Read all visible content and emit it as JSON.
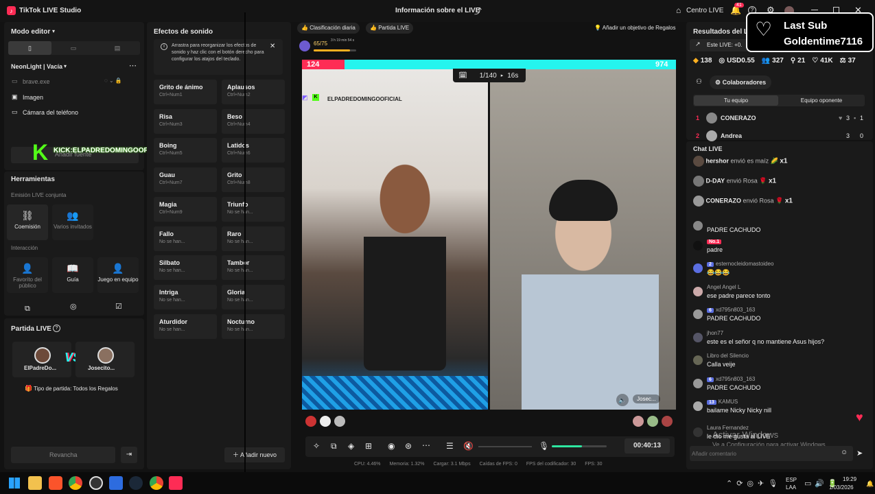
{
  "app": {
    "title": "TikTok LIVE Studio",
    "center_title": "Información sobre el LIVE",
    "centro_live": "Centro LIVE",
    "notif_count": "41"
  },
  "left": {
    "editor_mode": "Modo editor",
    "scene_name": "NeonLight | Vacía",
    "sources": [
      "brave.exe",
      "Imagen",
      "Cámara del teléfono"
    ],
    "add_source": "Añadir fuente",
    "overlay_text": "KICK:ELPADREDOMINGOOFICIAL1",
    "tools_title": "Herramientas",
    "joint_title": "Emisión LIVE conjunta",
    "tools_joint": [
      "Coemisión",
      "Varios invitados"
    ],
    "interaction_title": "Interacción",
    "tools_interaction": [
      "Favorito del público",
      "Guía",
      "Juego en equipo"
    ]
  },
  "match": {
    "title": "Partida LIVE",
    "player1": "ElPadreDo...",
    "player2": "Josecito...",
    "vs": "VS",
    "type_text": "Tipo de partida: Todos los Regalos",
    "rematch": "Revancha"
  },
  "sfx": {
    "title": "Efectos de sonido",
    "info": "Arrastra para reorganizar los efectos de sonido y haz clic con el botón derecho para configurar los atajos del teclado.",
    "items": [
      {
        "name": "Grito de ánimo",
        "key": "Ctrl+Num1"
      },
      {
        "name": "Aplausos",
        "key": "Ctrl+Num2"
      },
      {
        "name": "Risa",
        "key": "Ctrl+Num3"
      },
      {
        "name": "Beso",
        "key": "Ctrl+Num4"
      },
      {
        "name": "Boing",
        "key": "Ctrl+Num5"
      },
      {
        "name": "Latidos",
        "key": "Ctrl+Num6"
      },
      {
        "name": "Guau",
        "key": "Ctrl+Num7"
      },
      {
        "name": "Grito",
        "key": "Ctrl+Num8"
      },
      {
        "name": "Magia",
        "key": "Ctrl+Num9"
      },
      {
        "name": "Triunfo",
        "key": "No se han..."
      },
      {
        "name": "Fallo",
        "key": "No se han..."
      },
      {
        "name": "Raro",
        "key": "No se han..."
      },
      {
        "name": "Silbato",
        "key": "No se han..."
      },
      {
        "name": "Tambor",
        "key": "No se han..."
      },
      {
        "name": "Intriga",
        "key": "No se han..."
      },
      {
        "name": "Gloria",
        "key": "No se han..."
      },
      {
        "name": "Aturdidor",
        "key": "No se han..."
      },
      {
        "name": "Nocturno",
        "key": "No se han..."
      }
    ],
    "add_new": "Añadir nuevo"
  },
  "stage": {
    "daily_rank": "Clasificación diaria",
    "live_match": "Partida LIVE",
    "add_goal": "Añadir un objetivo de Regalos",
    "level": "65/75",
    "level_sub": "3 h 19 min 54 s",
    "score_left": "124",
    "score_right": "974",
    "battle_count": "1/140",
    "battle_timer": "16s",
    "watermark": "ELPADREDOMINGOOFICIAL",
    "guest_label": "Josec...",
    "elapsed": "00:40:13",
    "volume_level": 0.55,
    "perf": [
      "CPU: 4.46%",
      "Memoria: 1.32%",
      "Cargar: 3.1 Mbps",
      "Caídas de FPS: 0",
      "FPS del codificador: 30",
      "FPS: 30"
    ]
  },
  "results": {
    "title": "Resultados del LI",
    "this_live": "Este LIVE: +0.",
    "stats": [
      "138",
      "USD0.55",
      "327",
      "21",
      "41K",
      "37"
    ],
    "collab_title": "Colaboradores",
    "tab_team": "Tu equipo",
    "tab_opp": "Equipo oponente",
    "team": [
      {
        "rank": "1",
        "name": "CONERAZO",
        "a": "3",
        "b": "1"
      },
      {
        "rank": "2",
        "name": "Andrea",
        "a": "3",
        "b": "0"
      }
    ],
    "last_sub_label": "Last Sub",
    "last_sub_name": "Goldentime7116"
  },
  "chat": {
    "title": "Chat LIVE",
    "gifts": [
      {
        "user": "hershor",
        "text": "envió es maíz",
        "count": "x1"
      },
      {
        "user": "D-DAY",
        "text": "envió Rosa",
        "count": "x1"
      },
      {
        "user": "CONERAZO",
        "text": "envió Rosa",
        "count": "x1"
      }
    ],
    "messages": [
      {
        "user": "",
        "badge": "",
        "text": "PADRE CACHUDO"
      },
      {
        "user": "",
        "badge": "No.1",
        "text": "padre"
      },
      {
        "user": "esternocleidomastoideo",
        "badge": "2",
        "text": "😂😂😂"
      },
      {
        "user": "Angel Angel L",
        "badge": "",
        "text": "ese padre parece tonto"
      },
      {
        "user": "xd795n803_163",
        "badge": "6",
        "text": "PADRE CACHUDO"
      },
      {
        "user": "jhon77",
        "badge": "",
        "text": "este es el señor q no mantiene Asus hijos?"
      },
      {
        "user": "Libro del Silencio",
        "badge": "",
        "text": "Calla veije"
      },
      {
        "user": "xd795n803_163",
        "badge": "6",
        "text": "PADRE CACHUDO"
      },
      {
        "user": "KAMUS",
        "badge": "13",
        "text": "bailame Nicky Nicky nill"
      },
      {
        "user": "Laura Fernandez",
        "badge": "",
        "text": "le dio me gusta al LIVE"
      }
    ],
    "input_placeholder": "Añadir comentario",
    "activate_title": "Activar Windows",
    "activate_sub": "Ve a Configuración para activar Windows."
  },
  "taskbar": {
    "lang1": "ESP",
    "lang2": "LAA",
    "time": "19:29",
    "date": "1/03/2026"
  },
  "colors": {
    "accent": "#fe2c55",
    "cyan": "#25f4ee",
    "bg": "#121212",
    "panel": "#1a1a1a"
  }
}
